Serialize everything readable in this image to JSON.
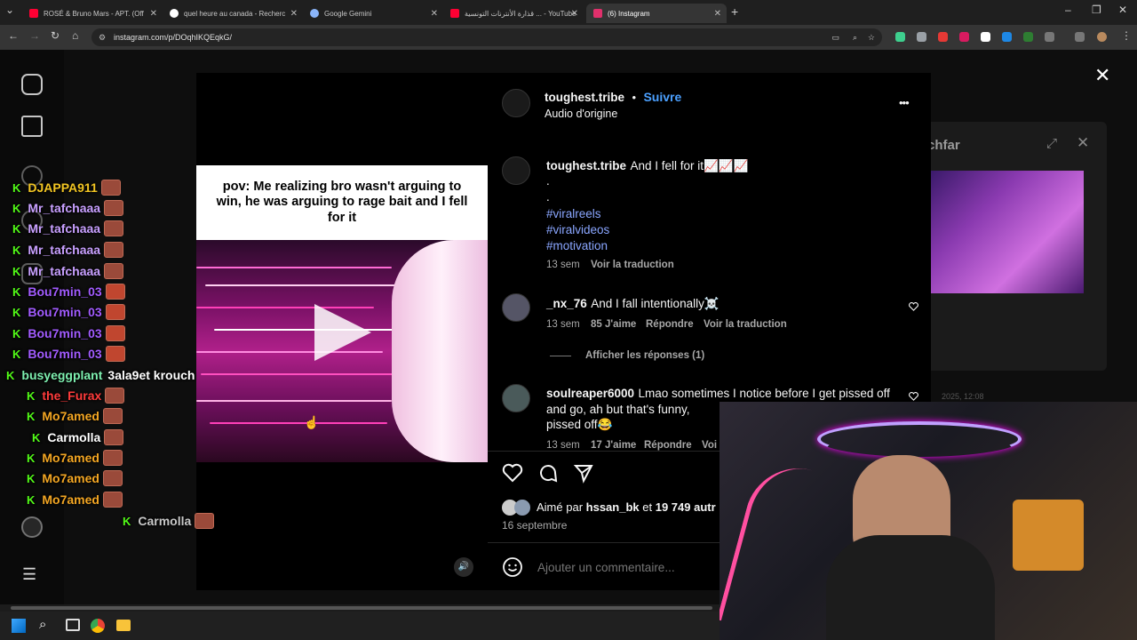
{
  "browser": {
    "tabs": [
      {
        "title": "ROSÉ & Bruno Mars - APT. (Off",
        "color": "#ff0033"
      },
      {
        "title": "quel heure au canada - Recherc",
        "color": "#ffffff"
      },
      {
        "title": "Google Gemini",
        "color": "#8ab4f8"
      },
      {
        "title": "قذارة الأنترنات التونسية ... - YouTube",
        "color": "#ff0033"
      },
      {
        "title": "(6) Instagram",
        "color": "#e1306c"
      }
    ],
    "url": "instagram.com/p/DOqhIKQEqkG/"
  },
  "post": {
    "author": "toughest.tribe",
    "follow_label": "Suivre",
    "audio": "Audio d'origine",
    "more_label": "•••",
    "video_caption": "pov: Me realizing bro wasn't arguing to win, he was arguing to rage bait and I fell for it",
    "description_author": "toughest.tribe",
    "description_text": "And I fell for it📈📈📈",
    "dot1": ".",
    "dot2": ".",
    "hashtags": [
      "#viralreels",
      "#viralvideos",
      "#motivation"
    ],
    "description_age": "13 sem",
    "translate_label": "Voir la traduction",
    "likes_text": "Aimé par",
    "likes_user": "hssan_bk",
    "likes_and": "et",
    "likes_count": "19 749 autr",
    "date": "16 septembre",
    "comment_placeholder": "Ajouter un commentaire..."
  },
  "comments": [
    {
      "user": "_nx_76",
      "text": "And I fall intentionally☠️",
      "age": "13 sem",
      "likes": "85 J'aime",
      "reply": "Répondre",
      "translate": "Voir la traduction"
    },
    {
      "user": "soulreaper6000",
      "text": "Lmao sometimes I notice before I get pissed off and go, ah but that's funny,",
      "text2": "pissed off😂",
      "age": "13 sem",
      "likes": "17 J'aime",
      "reply": "Répondre",
      "translate": "Voi"
    }
  ],
  "replies_label": "Afficher les réponses (1)",
  "close_label": "✕",
  "chat": [
    {
      "user": "DJAPPA911",
      "color": "#f3c623",
      "msg": ""
    },
    {
      "user": "Mr_tafchaaa",
      "color": "#c8a0ff",
      "msg": ""
    },
    {
      "user": "Mr_tafchaaa",
      "color": "#c8a0ff",
      "msg": ""
    },
    {
      "user": "Mr_tafchaaa",
      "color": "#c8a0ff",
      "msg": ""
    },
    {
      "user": "Mr_tafchaaa",
      "color": "#c8a0ff",
      "msg": ""
    },
    {
      "user": "Bou7min_03",
      "color": "#a25cff",
      "msg": ""
    },
    {
      "user": "Bou7min_03",
      "color": "#a25cff",
      "msg": ""
    },
    {
      "user": "Bou7min_03",
      "color": "#a25cff",
      "msg": ""
    },
    {
      "user": "Bou7min_03",
      "color": "#a25cff",
      "msg": ""
    },
    {
      "user": "busyeggplant",
      "color": "#7ef0b0",
      "msg": "3ala9et krouch"
    },
    {
      "user": "the_Furax",
      "color": "#ff3b3b",
      "msg": ""
    },
    {
      "user": "Mo7amed",
      "color": "#f3a623",
      "msg": ""
    },
    {
      "user": "Carmolla",
      "color": "#ffffff",
      "msg": ""
    },
    {
      "user": "Mo7amed",
      "color": "#f3a623",
      "msg": ""
    },
    {
      "user": "Mo7amed",
      "color": "#f3a623",
      "msg": ""
    },
    {
      "user": "Mo7amed",
      "color": "#f3a623",
      "msg": ""
    },
    {
      "user": "Carmolla",
      "color": "#c8c8c8",
      "msg": ""
    }
  ],
  "popup": {
    "title": "chfar",
    "date": "2025, 12:08"
  }
}
